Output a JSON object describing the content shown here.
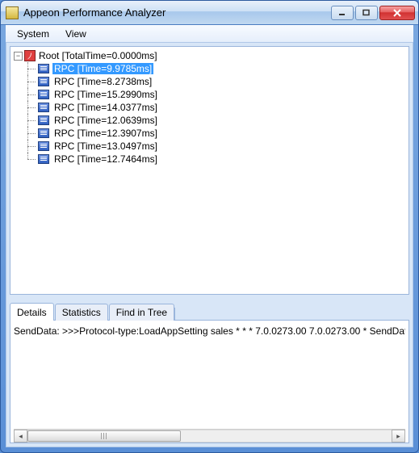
{
  "window": {
    "title": "Appeon Performance Analyzer"
  },
  "menu": {
    "system": "System",
    "view": "View"
  },
  "tree": {
    "root_label": "Root [TotalTime=0.0000ms]",
    "nodes": [
      {
        "label": "RPC [Time=9.9785ms]",
        "selected": true
      },
      {
        "label": "RPC [Time=8.2738ms]",
        "selected": false
      },
      {
        "label": "RPC [Time=15.2990ms]",
        "selected": false
      },
      {
        "label": "RPC [Time=14.0377ms]",
        "selected": false
      },
      {
        "label": "RPC [Time=12.0639ms]",
        "selected": false
      },
      {
        "label": "RPC [Time=12.3907ms]",
        "selected": false
      },
      {
        "label": "RPC [Time=13.0497ms]",
        "selected": false
      },
      {
        "label": "RPC [Time=12.7464ms]",
        "selected": false
      }
    ]
  },
  "tabs": {
    "details": "Details",
    "statistics": "Statistics",
    "find_in_tree": "Find in Tree"
  },
  "detail_content": "SendData: >>>Protocol-type:LoadAppSetting  sales  * * * 7.0.0273.00 7.0.0273.00 *   SendDat"
}
